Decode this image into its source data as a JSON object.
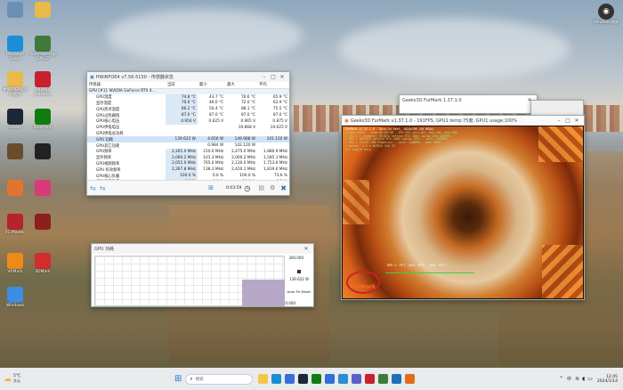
{
  "desktop": {
    "icons": [
      {
        "label": "",
        "icon": "file-icon",
        "color": "#6b8fb7"
      },
      {
        "label": "",
        "icon": "folder-icon",
        "color": "#e9b94a"
      },
      {
        "label": "Microsoft Edge",
        "icon": "edge-icon",
        "color": "#1a8fd6"
      },
      {
        "label": "TechPowerUp GPU-Z",
        "icon": "gpuz-icon",
        "color": "#3f7a3a"
      },
      {
        "label": "更新的GPU测试截图",
        "icon": "folder-icon",
        "color": "#e9b94a"
      },
      {
        "label": "AIDA64 Extreme",
        "icon": "aida64-icon",
        "color": "#c8202f"
      },
      {
        "label": "Steam",
        "icon": "steam-icon",
        "color": "#1b2838"
      },
      {
        "label": "Xbox App",
        "icon": "xbox-icon",
        "color": "#107c10"
      },
      {
        "label": "",
        "icon": "avatar-icon",
        "color": "#6a4b2c"
      },
      {
        "label": "",
        "icon": "circle-icon",
        "color": "#222222"
      },
      {
        "label": "",
        "icon": "game-icon",
        "color": "#e0762b"
      },
      {
        "label": "",
        "icon": "gear-icon",
        "color": "#d93b7a"
      },
      {
        "label": "FC Master",
        "icon": "app-icon",
        "color": "#b3242f"
      },
      {
        "label": "",
        "icon": "app-icon",
        "color": "#8a2020"
      },
      {
        "label": "VRMark",
        "icon": "app-icon",
        "color": "#f08a17"
      },
      {
        "label": "3DMark",
        "icon": "app-icon",
        "color": "#d32c2c"
      },
      {
        "label": "Windows",
        "icon": "app-icon",
        "color": "#3a8ee6"
      }
    ],
    "top_right_icon": {
      "label": "Windows通知",
      "icon": "user-icon"
    }
  },
  "hwinfo": {
    "title": "HWiNFO64 v7.56-5150 - 传感器状态",
    "columns": [
      "传感器",
      "当前",
      "最小",
      "最大",
      "平均"
    ],
    "rows": [
      {
        "name": "GPU [#1]: NVIDIA GeForce RTX 4...",
        "cur": "",
        "min": "",
        "max": "",
        "avg": "",
        "type": "header"
      },
      {
        "name": "GPU温度",
        "cur": "74.8 °C",
        "min": "43.7 °C",
        "max": "76.6 °C",
        "avg": "65.9 °C",
        "type": "normal"
      },
      {
        "name": "显存温度",
        "cur": "70.0 °C",
        "min": "46.0 °C",
        "max": "72.0 °C",
        "avg": "62.9 °C",
        "type": "normal"
      },
      {
        "name": "GPU热点温度",
        "cur": "86.2 °C",
        "min": "50.4 °C",
        "max": "88.1 °C",
        "avg": "75.5 °C",
        "type": "normal"
      },
      {
        "name": "GPU过热阈值",
        "cur": "87.0 °C",
        "min": "87.0 °C",
        "max": "87.0 °C",
        "avg": "87.0 °C",
        "type": "normal"
      },
      {
        "name": "GPU核心电压",
        "cur": "0.950 V",
        "min": "0.625 V",
        "max": "0.965 V",
        "avg": "0.875 V",
        "type": "normal"
      },
      {
        "name": "GPU供电电压",
        "cur": "",
        "min": "",
        "max": "19.868 V",
        "avg": "19.625 V",
        "type": "normal"
      },
      {
        "name": "GPU供电总功耗",
        "cur": "",
        "min": "",
        "max": "",
        "avg": "",
        "type": "normal"
      },
      {
        "name": "GPU 功耗",
        "cur": "139.622 W",
        "min": "4.656 W",
        "max": "149.988 W",
        "avg": "101.120 W",
        "type": "selected"
      },
      {
        "name": "GPU其它功耗",
        "cur": "",
        "min": "0.984 W",
        "max": "142.120 W",
        "avg": "",
        "type": "normal"
      },
      {
        "name": "GPU频率",
        "cur": "2,265.0 MHz",
        "min": "210.0 MHz",
        "max": "2,475.0 MHz",
        "avg": "1,880.9 MHz",
        "type": "normal"
      },
      {
        "name": "显存频率",
        "cur": "2,000.2 MHz",
        "min": "101.3 MHz",
        "max": "2,000.2 MHz",
        "avg": "1,585.1 MHz",
        "type": "normal"
      },
      {
        "name": "GPU视频频率",
        "cur": "2,055.0 MHz",
        "min": "765.0 MHz",
        "max": "2,130.0 MHz",
        "avg": "1,753.6 MHz",
        "type": "normal"
      },
      {
        "name": "GPU 有效频率",
        "cur": "2,267.8 MHz",
        "min": "138.3 MHz",
        "max": "2,420.1 MHz",
        "avg": "1,819.6 MHz",
        "type": "normal"
      },
      {
        "name": "GPU核心负载",
        "cur": "100.0 %",
        "min": "0.0 %",
        "max": "100.0 %",
        "avg": "73.6 %",
        "type": "normal"
      },
      {
        "name": "GPU显存负载",
        "cur": "9.0 %",
        "min": "0.0 %",
        "max": "10.0 %",
        "avg": "6.5 %",
        "type": "normal"
      }
    ],
    "timer": "0:03:59",
    "toolbar": [
      "arrow-left-right-icon",
      "arrow-left-right-icon",
      "network-icon",
      "clock-icon",
      "report-icon",
      "settings-icon",
      "close-x-icon"
    ]
  },
  "gpu_graph": {
    "title": "GPU 功耗",
    "max_label": "300.000",
    "current_label": "139.622 W",
    "min_label": "0.000",
    "auto_fit_label": "Auto Fit",
    "reset_label": "Reset"
  },
  "geeks3d_back": {
    "title": "Geeks3D FurMark 1.37.1.0"
  },
  "furmark": {
    "title": "Geeks3D FurMark v1.37.1.0 - 191FPS, GPU1 temp:75度, GPU1 usage:100%",
    "logo_text": "FurMark",
    "overlay_lines": [
      "FurMark v1.37.1.0 - Burn-in test, 1024x768 (0X MSAA)",
      "Frames:40637 - time:00:03:48 - FPS:191 (min:183, max:286, avg:190)",
      "[ GPU-Z ] renderer: NVIDIA GeForce RTX 4060 Laptop GPU 1890MHz",
      "> GPU 1 (NVIDIA GeForce RTX 4060 Laptop GPU) - core: 2265MHz",
      "> GPU 2 (Intel UHD Graphics) - core: 1400MHz - mem: 0MHz",
      "> OpenGL: 4.6.0 NVIDIA 546.33",
      "F1: toggle help"
    ],
    "graph_line": "GPU 1: 75°C (min: 43°C - max: 76°C)"
  },
  "taskbar": {
    "weather_temp": "5°C",
    "weather_desc": "多云",
    "search_placeholder": "搜索",
    "apps": [
      {
        "icon": "file-explorer-icon",
        "color": "#f3c64b"
      },
      {
        "icon": "edge-icon",
        "color": "#1a8fd6"
      },
      {
        "icon": "store-icon",
        "color": "#3a6fd8"
      },
      {
        "icon": "steam-icon",
        "color": "#1b2838"
      },
      {
        "icon": "xbox-icon",
        "color": "#107c10"
      },
      {
        "icon": "mail-icon",
        "color": "#2f6fd6"
      },
      {
        "icon": "photos-icon",
        "color": "#2e8bd6"
      },
      {
        "icon": "teams-icon",
        "color": "#5b5fc7"
      },
      {
        "icon": "aida64-icon",
        "color": "#c8202f"
      },
      {
        "icon": "gpuz-icon",
        "color": "#3f7a3a"
      },
      {
        "icon": "hwinfo-icon",
        "color": "#1e6fb8"
      },
      {
        "icon": "furmark-icon",
        "color": "#e26c19"
      }
    ],
    "tray_lang": "中",
    "time": "12:45",
    "date": "2024/1/14"
  }
}
